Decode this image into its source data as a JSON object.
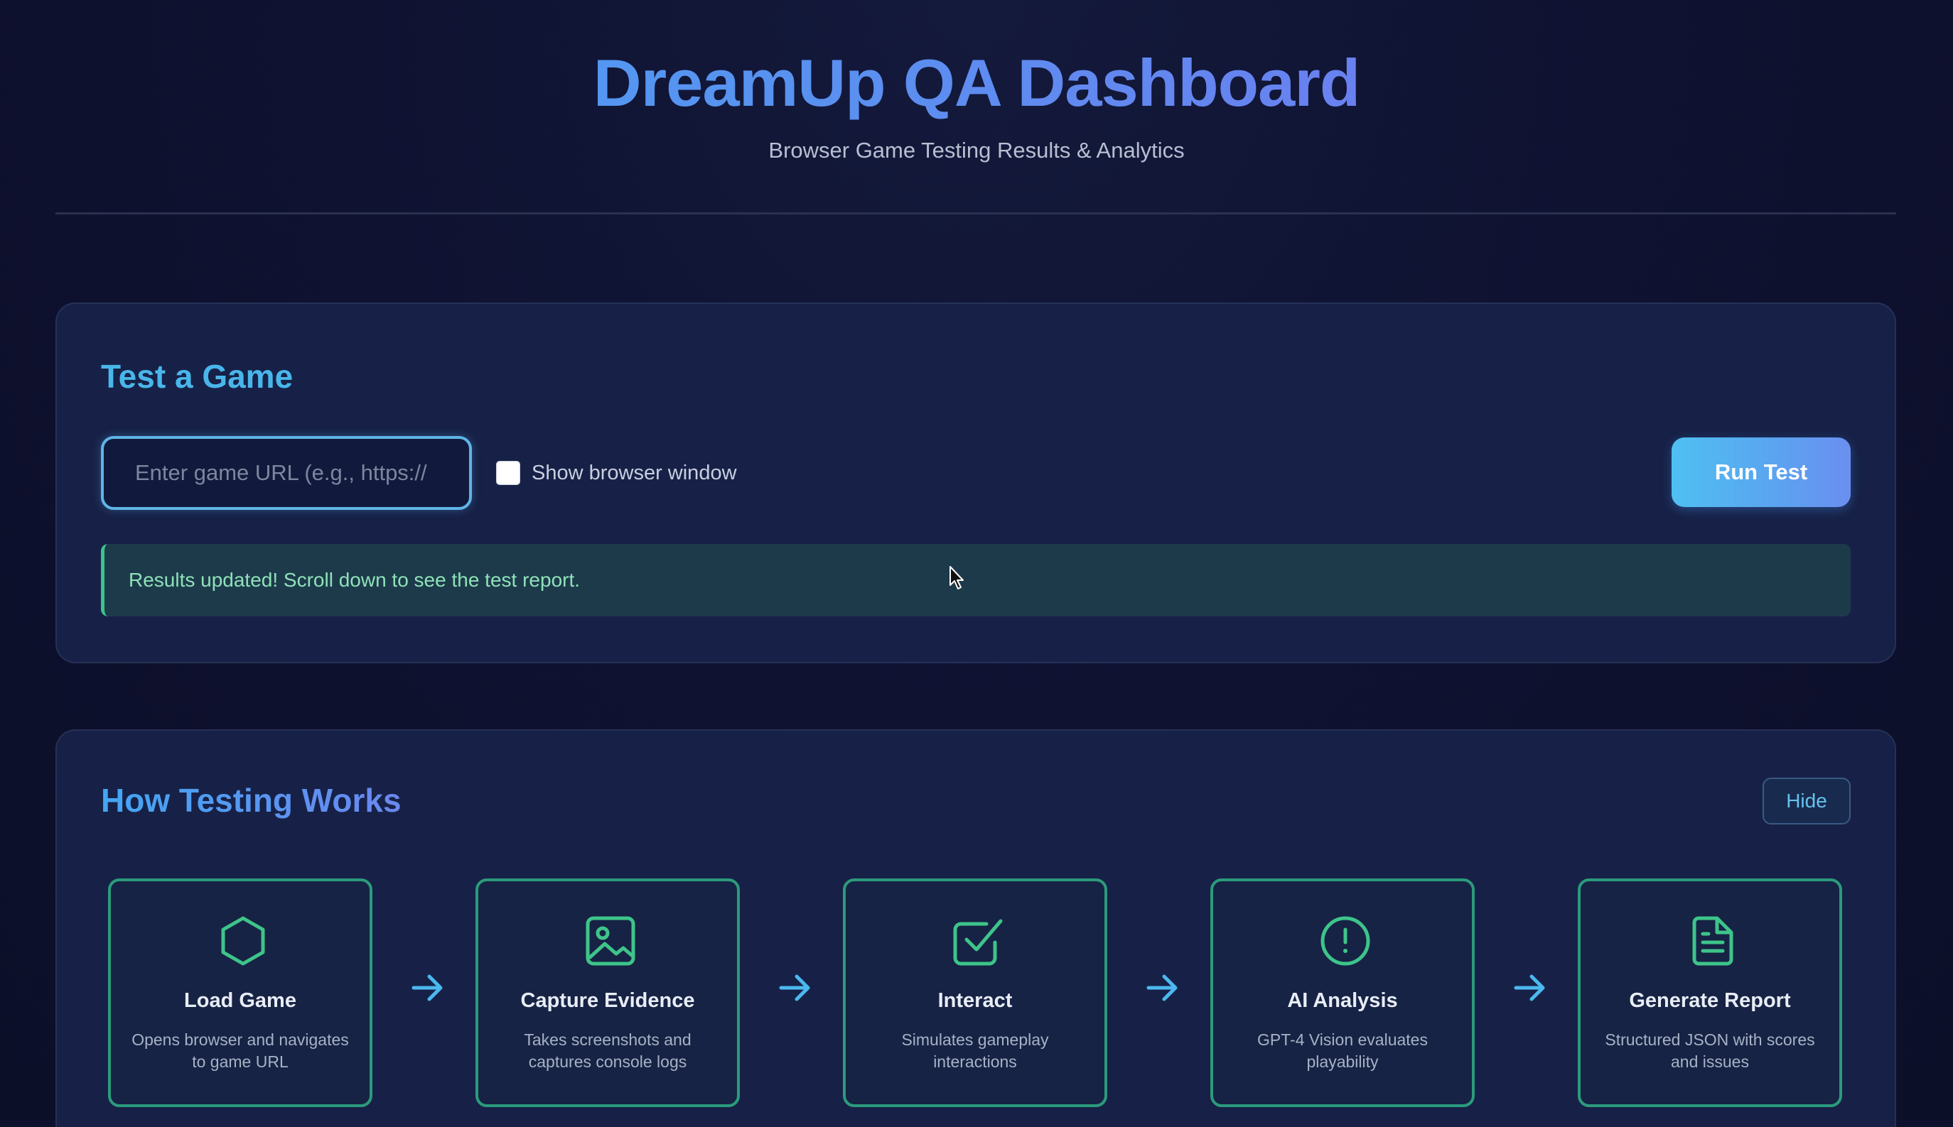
{
  "header": {
    "title": "DreamUp QA Dashboard",
    "subtitle": "Browser Game Testing Results & Analytics"
  },
  "test_section": {
    "title": "Test a Game",
    "url_input": {
      "placeholder": "Enter game URL (e.g., https://",
      "value": ""
    },
    "show_browser_checkbox": {
      "label": "Show browser window",
      "checked": false
    },
    "run_button_label": "Run Test",
    "status_message": "Results updated! Scroll down to see the test report."
  },
  "how_section": {
    "title": "How Testing Works",
    "hide_button_label": "Hide",
    "steps": [
      {
        "icon": "hexagon-icon",
        "title": "Load Game",
        "desc": "Opens browser and navigates to game URL"
      },
      {
        "icon": "image-icon",
        "title": "Capture Evidence",
        "desc": "Takes screenshots and captures console logs"
      },
      {
        "icon": "checkbox-icon",
        "title": "Interact",
        "desc": "Simulates gameplay interactions"
      },
      {
        "icon": "info-circle-icon",
        "title": "AI Analysis",
        "desc": "GPT-4 Vision evaluates playability"
      },
      {
        "icon": "document-icon",
        "title": "Generate Report",
        "desc": "Structured JSON with scores and issues"
      }
    ]
  },
  "colors": {
    "background": "#0f1231",
    "card": "#172147",
    "accent_blue": "#49b6ea",
    "accent_purple": "#7a6ff0",
    "step_border": "#2b9b7c",
    "success_text": "#8ee2b8",
    "success_border": "#3ec48a"
  }
}
